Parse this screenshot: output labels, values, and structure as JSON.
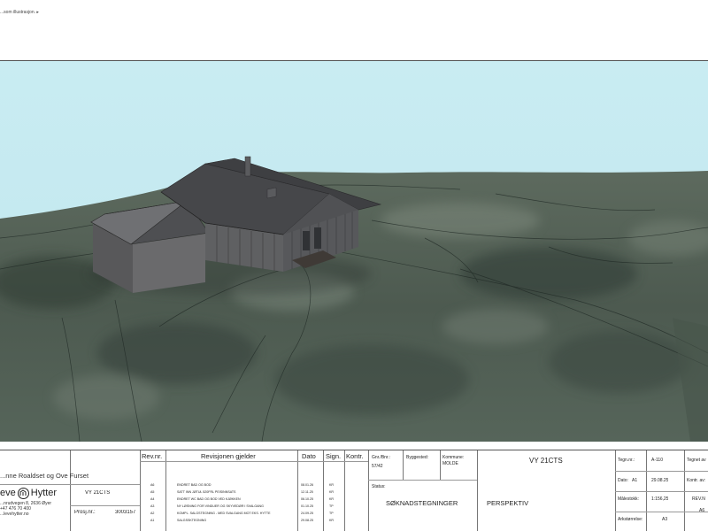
{
  "top_note": "...som illustrasjon. ▸",
  "titleblock": {
    "clients": "...nne Roaldset og Ove Furset",
    "company": {
      "logo_left": "eve",
      "logo_right": "Hytter",
      "address": "...nrudvegen 8, 2636 Øyer",
      "phone": "+47 476 70 400",
      "web": "...levehytter.no"
    },
    "project_name": "VY 21CTS",
    "project_no_label": "Prosj.nr.:",
    "project_no": "3003157",
    "rev_headers": {
      "rev_no": "Rev.nr.",
      "description": "Revisjonen gjelder",
      "date": "Dato",
      "sign": "Sign.",
      "control": "Kontr."
    },
    "revisions": [
      {
        "rev": "A6",
        "desc": "ENDRET BAD OG BOD",
        "date": "08.01.26",
        "sign": "KR"
      },
      {
        "rev": "A5",
        "desc": "SATT INN JØTUL 520FRL PEISINNSATS",
        "date": "12.11.25",
        "sign": "KR"
      },
      {
        "rev": "A4",
        "desc": "ENDRET WC BAD OG BOD VED KJØKKEN",
        "date": "06.10.25",
        "sign": "KR"
      },
      {
        "rev": "A3",
        "desc": "NY LØSNING FOR VINDUER OG SKYVEDØR I SVALGANG",
        "date": "01.10.25",
        "sign": "TP"
      },
      {
        "rev": "A2",
        "desc": "KOMPL. SALGSTEGNING - MED SVALGANG MOT EKS. HYTTE",
        "date": "24.09.25",
        "sign": "TP"
      },
      {
        "rev": "A1",
        "desc": "SALGSSKTEGNING",
        "date": "29.08.25",
        "sign": "KR"
      }
    ],
    "gnr_label": "Gnr./Bnr.:",
    "gnr_value": "57/42",
    "byggested_label": "Byggested:",
    "kommune_label": "Kommune:",
    "kommune_value": "MOLDE",
    "status_label": "Status:",
    "status_value": "SØKNADSTEGNINGER",
    "drawing_title": "VY 21CTS",
    "drawing_type": "PERSPEKTIV",
    "tegn_label": "Tegn.nr.:",
    "tegn_value": "A-110",
    "dato_label": "Dato:",
    "dato_size": "A1",
    "dato_value": "29.08.25",
    "malestokk_label": "Målestokk:",
    "malestokk_value": "1:156,25",
    "ark_label": "Arkstørrelse:",
    "ark_value": "A3",
    "tegnet_label": "Tegnet av",
    "kontr_label": "Kontr. av:",
    "revn_label": "REV.N",
    "revn_value": "A6"
  }
}
